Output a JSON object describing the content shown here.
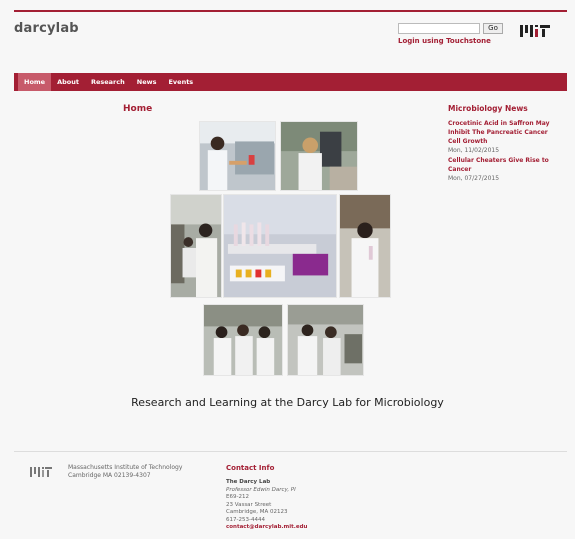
{
  "header": {
    "site_name": "darcylab",
    "search_placeholder": "",
    "go_label": "Go",
    "login_label": "Login using Touchstone"
  },
  "nav": {
    "items": [
      {
        "label": "Home",
        "active": true
      },
      {
        "label": "About",
        "active": false
      },
      {
        "label": "Research",
        "active": false
      },
      {
        "label": "News",
        "active": false
      },
      {
        "label": "Events",
        "active": false
      }
    ]
  },
  "main": {
    "title": "Home",
    "tagline": "Research and Learning at the Darcy Lab for Microbiology"
  },
  "news": {
    "heading": "Microbiology News",
    "items": [
      {
        "title": "Crocetinic Acid in Saffron May Inhibit The Pancreatic Cancer Cell Growth",
        "date": "Mon, 11/02/2015"
      },
      {
        "title": "Cellular Cheaters Give Rise to Cancer",
        "date": "Mon, 07/27/2015"
      }
    ]
  },
  "footer": {
    "institution": "Massachusetts Institute of Technology",
    "address": "Cambridge MA 02139-4307",
    "contact_heading": "Contact Info",
    "contact_lines": {
      "lab": "The Darcy Lab",
      "professor": "Professor Edwin Darcy, PI",
      "room": "E69-212",
      "street": "23 Vassar Street",
      "city": "Cambridge, MA 02123",
      "phone": "617-253-4444",
      "email": "contact@darcylab.mit.edu"
    }
  },
  "colors": {
    "brand": "#a31f34",
    "nav_active": "#c75a6a",
    "background": "#f7f7f7"
  }
}
